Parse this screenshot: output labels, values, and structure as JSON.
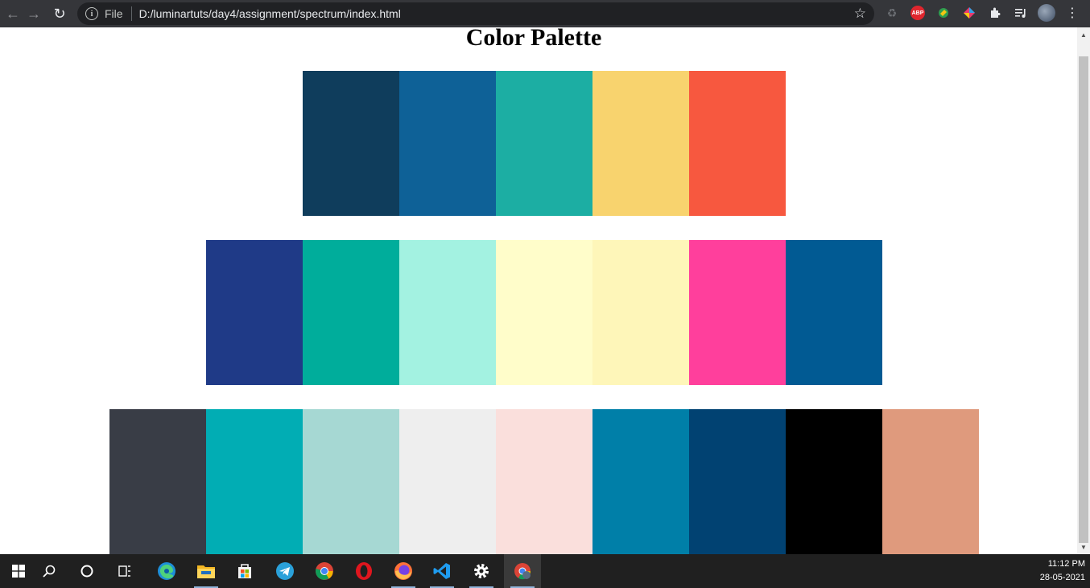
{
  "browser": {
    "scheme_label": "File",
    "url": "D:/luminartuts/day4/assignment/spectrum/index.html",
    "abp_label": "ABP"
  },
  "page": {
    "title": "Color Palette",
    "rows": [
      {
        "colors": [
          "#0f3d5c",
          "#0e6197",
          "#1caea3",
          "#f8d36e",
          "#f7583f"
        ]
      },
      {
        "colors": [
          "#1f3a87",
          "#00ad9b",
          "#a3f2e1",
          "#fffdca",
          "#fef6b9",
          "#ff3f9c",
          "#015a93"
        ]
      },
      {
        "colors": [
          "#393d46",
          "#01adb4",
          "#a6d8d3",
          "#eeeeee",
          "#fadfdc",
          "#007fa8",
          "#014272",
          "#000000",
          "#df9a7d"
        ]
      }
    ]
  },
  "taskbar": {
    "time": "11:12 PM",
    "date": "28-05-2021",
    "apps": [
      "start-icon",
      "search-icon",
      "cortana-icon",
      "task-view-icon",
      "edge-icon",
      "file-explorer-icon",
      "store-icon",
      "telegram-icon",
      "chrome-icon",
      "opera-icon",
      "firefox-icon",
      "vscode-icon",
      "settings-icon",
      "chrome-profile-icon"
    ]
  }
}
